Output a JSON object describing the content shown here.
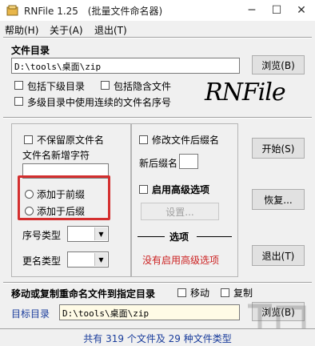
{
  "window": {
    "title": "RNFile 1.25",
    "subtitle": "(批量文件命名器)",
    "minimize_glyph": "─",
    "maximize_glyph": "☐",
    "close_glyph": "✕"
  },
  "menu": [
    "帮助(H)",
    "关于(A)",
    "退出(T)"
  ],
  "folder": {
    "section_label": "文件目录",
    "path_value": "D:\\tools\\桌面\\zip",
    "browse_label": "浏览(B)",
    "include_subdirs": "包括下级目录",
    "include_hidden": "包括隐含文件",
    "multi_dir_sequence": "多级目录中使用连续的文件名序号",
    "logo_text": "RNFile"
  },
  "left_panel": {
    "keep_original_name": "不保留原文件名",
    "new_chars_label": "文件名新增字符",
    "new_chars_value": "",
    "add_prefix": "添加于前缀",
    "add_suffix": "添加于后缀",
    "sequence_type_label": "序号类型",
    "rename_type_label": "更名类型"
  },
  "mid_panel": {
    "modify_ext": "修改文件后缀名",
    "new_ext_label": "新后缀名",
    "new_ext_value": "",
    "enable_advanced": "启用高级选项",
    "settings_button": "设置...",
    "options_label": "选项",
    "advanced_status": "没有启用高级选项"
  },
  "actions": {
    "start": "开始(S)",
    "restore": "恢复...",
    "exit": "退出(T)"
  },
  "move_copy": {
    "section_label": "移动或复制重命名文件到指定目录",
    "move_label": "移动",
    "copy_label": "复制",
    "target_label": "目标目录",
    "target_value": "D:\\tools\\桌面\\zip",
    "browse_label": "浏览(B)"
  },
  "status": {
    "text": "共有 319 个文件及 29 种文件类型"
  },
  "colors": {
    "highlight_box": "#d42f2f",
    "advanced_status": "#cc2222",
    "target_label": "#1a3d9c"
  }
}
